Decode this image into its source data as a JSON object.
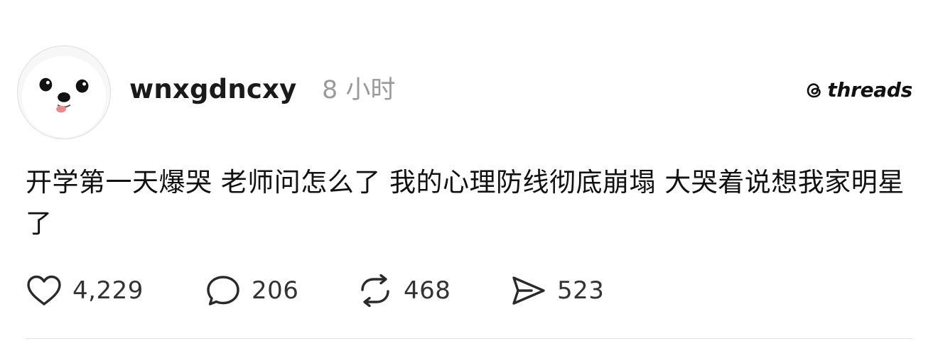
{
  "post": {
    "username": "wnxgdncxy",
    "timestamp": "8 小时",
    "text": "开学第一天爆哭 老师问怎么了 我的心理防线彻底崩塌 大哭着说想我家明星了",
    "avatar_icon": "white-pomeranian-dog-avatar"
  },
  "branding": {
    "logo_text": "threads",
    "logo_icon": "threads-logo-icon"
  },
  "actions": {
    "likes": {
      "icon": "heart-icon",
      "count": "4,229"
    },
    "replies": {
      "icon": "comment-bubble-icon",
      "count": "206"
    },
    "reposts": {
      "icon": "repost-arrows-icon",
      "count": "468"
    },
    "shares": {
      "icon": "send-paper-plane-icon",
      "count": "523"
    }
  },
  "colors": {
    "text_primary": "#101010",
    "text_secondary": "#9a9a9a",
    "divider": "#dedede",
    "background": "#ffffff"
  }
}
